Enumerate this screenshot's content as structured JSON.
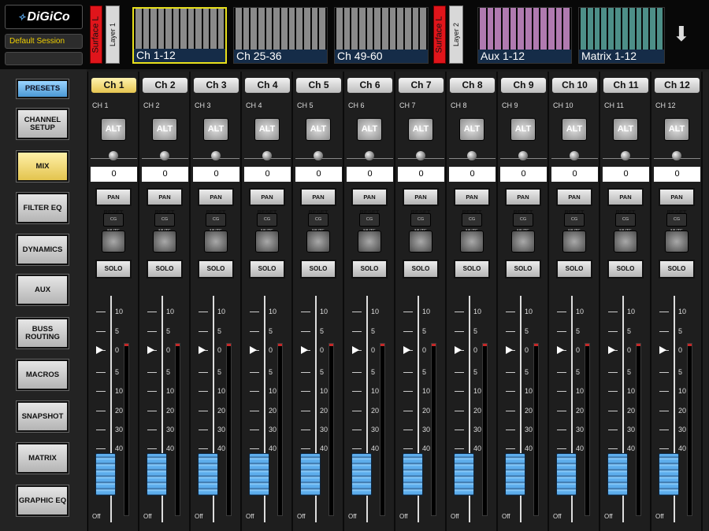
{
  "header": {
    "logo_text": "DiGiCo",
    "session_name": "Default Session",
    "surface_left_label": "Surface L",
    "layer1_label": "Layer 1",
    "layer2_label": "Layer 2",
    "banks": [
      {
        "label": "Ch 1-12",
        "color": "#8a8a8a",
        "selected": true
      },
      {
        "label": "Ch 25-36",
        "color": "#8a8a8a",
        "selected": false
      },
      {
        "label": "Ch 49-60",
        "color": "#8a8a8a",
        "selected": false
      },
      {
        "label": "Aux 1-12",
        "color": "#b07ab0",
        "selected": false
      },
      {
        "label": "Matrix 1-12",
        "color": "#4d8f88",
        "selected": false
      }
    ],
    "scroll_icon": "down-arrow-icon"
  },
  "sidebar": {
    "items": [
      {
        "label": "PRESETS"
      },
      {
        "label": "CHANNEL SETUP"
      },
      {
        "label": "MIX"
      },
      {
        "label": "FILTER EQ"
      },
      {
        "label": "DYNAMICS"
      },
      {
        "label": "AUX"
      },
      {
        "label": "BUSS ROUTING"
      },
      {
        "label": "MACROS"
      },
      {
        "label": "SNAPSHOT"
      },
      {
        "label": "MATRIX"
      },
      {
        "label": "GRAPHIC EQ"
      }
    ]
  },
  "channels": [
    {
      "tab": "Ch 1",
      "name": "CH 1",
      "pan": "0"
    },
    {
      "tab": "Ch 2",
      "name": "CH 2",
      "pan": "0"
    },
    {
      "tab": "Ch 3",
      "name": "CH 3",
      "pan": "0"
    },
    {
      "tab": "Ch 4",
      "name": "CH 4",
      "pan": "0"
    },
    {
      "tab": "Ch 5",
      "name": "CH 5",
      "pan": "0"
    },
    {
      "tab": "Ch 6",
      "name": "CH 6",
      "pan": "0"
    },
    {
      "tab": "Ch 7",
      "name": "CH 7",
      "pan": "0"
    },
    {
      "tab": "Ch 8",
      "name": "CH 8",
      "pan": "0"
    },
    {
      "tab": "Ch 9",
      "name": "CH 9",
      "pan": "0"
    },
    {
      "tab": "Ch 10",
      "name": "CH 10",
      "pan": "0"
    },
    {
      "tab": "Ch 11",
      "name": "CH 11",
      "pan": "0"
    },
    {
      "tab": "Ch 12",
      "name": "CH 12",
      "pan": "0"
    }
  ],
  "channel_strip": {
    "alt_label": "ALT",
    "pan_reset_label": "PAN RESET",
    "cg_mute_label": "CG MUTE",
    "solo_label": "SOLO",
    "fader_value": "Off",
    "fader_scale": [
      "10",
      "5",
      "0",
      "5",
      "10",
      "20",
      "30",
      "40"
    ]
  },
  "selected_channel": "Ch 1",
  "colors": {
    "accent_yellow": "#e8e01c",
    "presets_blue": "#4b98d4",
    "fader_blue": "#5dadec"
  }
}
